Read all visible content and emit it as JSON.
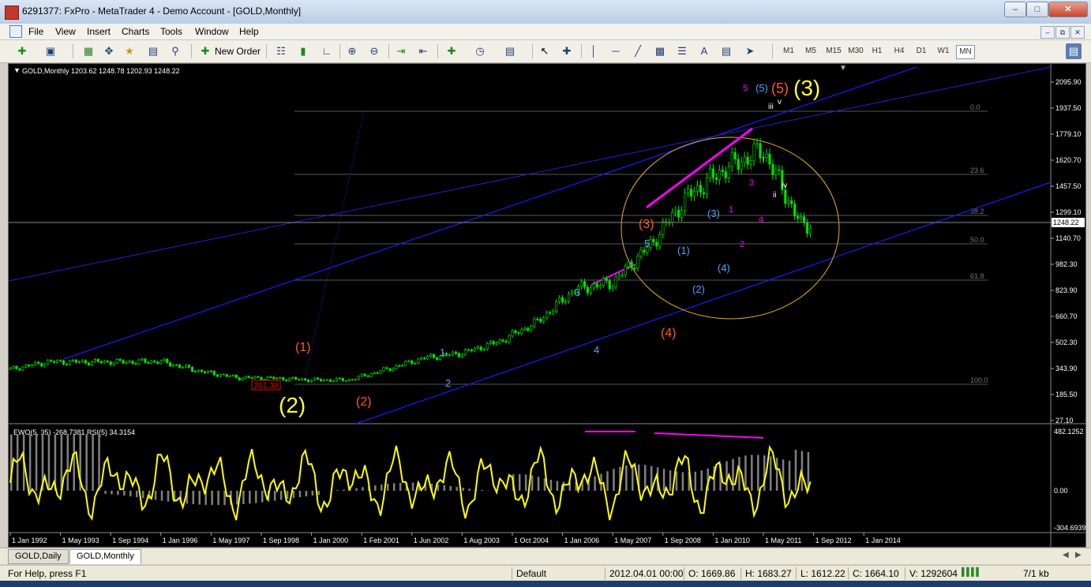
{
  "window": {
    "title": "6291377: FxPro - MetaTrader 4 - Demo Account - [GOLD,Monthly]"
  },
  "menu": [
    "File",
    "View",
    "Insert",
    "Charts",
    "Tools",
    "Window",
    "Help"
  ],
  "toolbar": {
    "new_order_label": "New Order",
    "timeframes": [
      "M1",
      "M5",
      "M15",
      "M30",
      "H1",
      "H4",
      "D1",
      "W1",
      "MN"
    ],
    "active_timeframe": "MN"
  },
  "chart": {
    "header": "GOLD,Monthly  1203.62 1248.78 1202.93 1248.22",
    "indicator_header": "EWO(5, 35) -268.7381  RSI(5) 34.3154",
    "current_price": "1248.22",
    "low_label": "251.30",
    "price_axis": [
      "2095.90",
      "1937.50",
      "1779.10",
      "1620.70",
      "1457.50",
      "1299.10",
      "1140.70",
      "982.30",
      "823.90",
      "660.70",
      "502.30",
      "343.90",
      "185.50",
      "27.10"
    ],
    "indicator_axis": [
      "482.1252",
      "0.00",
      "-304.6939"
    ],
    "time_axis": [
      "1 Jan 1992",
      "1 May 1993",
      "1 Sep 1994",
      "1 Jan 1996",
      "1 May 1997",
      "1 Sep 1998",
      "1 Jan 2000",
      "1 Feb 2001",
      "1 Jun 2002",
      "1 Aug 2003",
      "1 Oct 2004",
      "1 Jan 2006",
      "1 May 2007",
      "1 Sep 2008",
      "1 Jan 2010",
      "1 May 2011",
      "1 Sep 2012",
      "1 Jan 2014"
    ],
    "fib_levels": [
      "0.0",
      "23.6",
      "38.2",
      "50.0",
      "61.8",
      "100.0"
    ],
    "wave_labels": {
      "yellow": [
        "(2)",
        "(3)"
      ],
      "orange": [
        "(1)",
        "(2)",
        "(3)",
        "(4)",
        "(5)"
      ],
      "blue": [
        "1",
        "2",
        "3",
        "4",
        "5",
        "(1)",
        "(2)",
        "(3)",
        "(4)",
        "(5)"
      ],
      "magenta": [
        "1",
        "2",
        "3",
        "4",
        "5"
      ],
      "white": [
        "i",
        "ii",
        "iii",
        "iv",
        "v"
      ]
    },
    "colors": {
      "candles": "#00e000",
      "channel": "#1a1aff",
      "ellipse": "#e8b020",
      "rsi": "#ffff00",
      "ewo": "#808080",
      "divergence": "#ff00ff",
      "wave_yellow": "#ffff33",
      "wave_orange": "#ff5a1f",
      "wave_blue": "#4aa3ff"
    }
  },
  "chart_data": {
    "type": "candlestick",
    "symbol": "GOLD",
    "timeframe": "Monthly",
    "x": [
      "1992",
      "1993",
      "1994",
      "1995",
      "1996",
      "1997",
      "1998",
      "1999",
      "2000",
      "2001",
      "2002",
      "2003",
      "2004",
      "2005",
      "2006",
      "2007",
      "2008",
      "2009",
      "2010",
      "2011",
      "2012",
      "2013",
      "2014"
    ],
    "close": [
      340,
      385,
      385,
      385,
      388,
      330,
      290,
      285,
      275,
      275,
      340,
      410,
      440,
      510,
      630,
      830,
      870,
      1100,
      1400,
      1570,
      1680,
      1220,
      1248
    ],
    "ylim": [
      27.1,
      2095.9
    ],
    "fib_levels_pct": [
      0.0,
      23.6,
      38.2,
      50.0,
      61.8,
      100.0
    ]
  },
  "tabs": [
    "GOLD,Daily",
    "GOLD,Monthly"
  ],
  "active_tab": "GOLD,Monthly",
  "status": {
    "help": "For Help, press F1",
    "profile": "Default",
    "datetime": "2012.04.01 00:00",
    "open": "O: 1669.86",
    "high": "H: 1683.27",
    "low": "L: 1612.22",
    "close": "C: 1664.10",
    "volume": "V: 1292604",
    "traffic": "7/1 kb"
  }
}
